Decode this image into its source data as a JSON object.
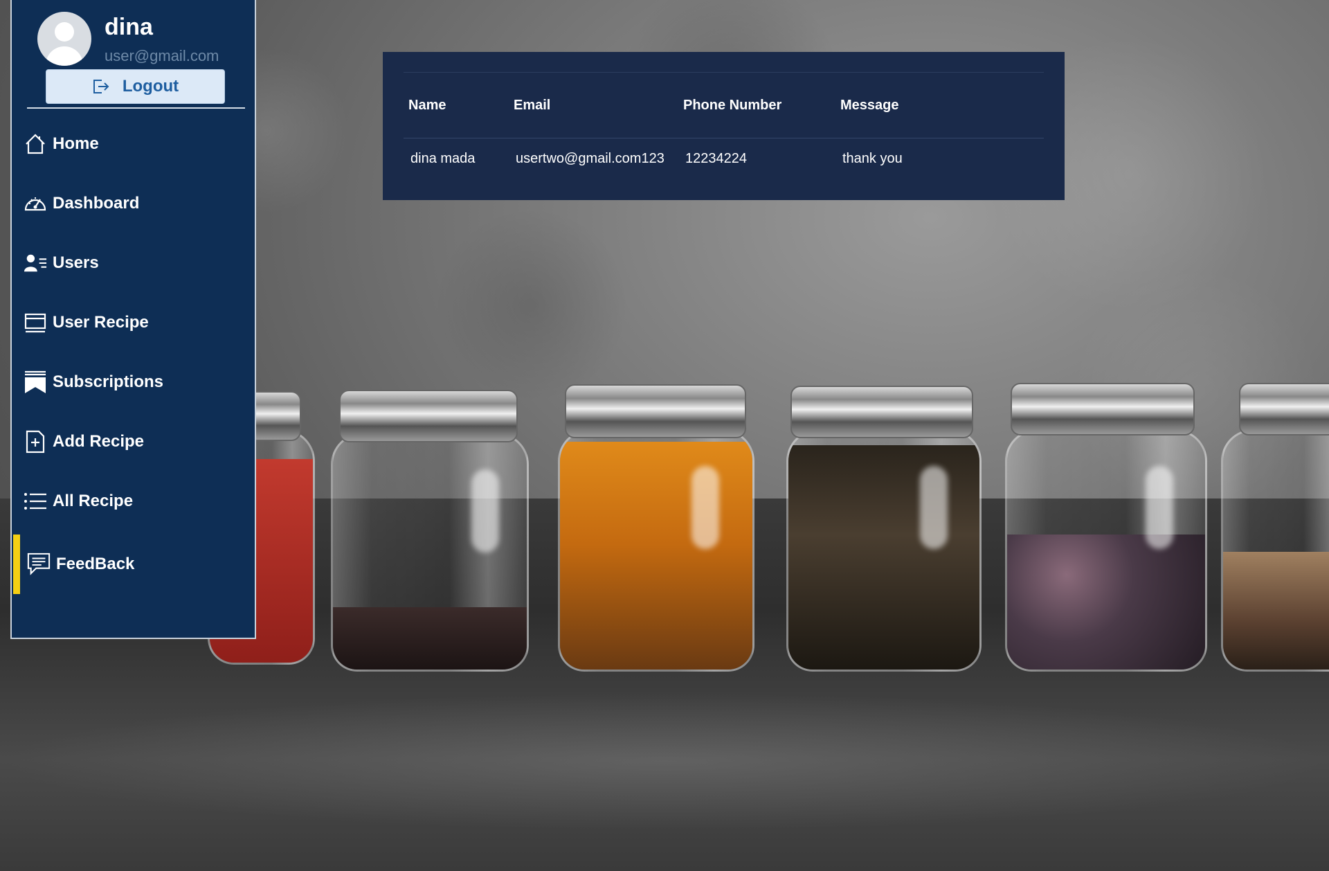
{
  "user": {
    "name": "dina",
    "email": "user@gmail.com",
    "logout_label": "Logout"
  },
  "sidebar": {
    "items": [
      {
        "label": "Home",
        "icon": "home-icon"
      },
      {
        "label": "Dashboard",
        "icon": "speedometer-icon"
      },
      {
        "label": "Users",
        "icon": "users-icon"
      },
      {
        "label": "User Recipe",
        "icon": "window-icon"
      },
      {
        "label": "Subscriptions",
        "icon": "bookmark-icon"
      },
      {
        "label": "Add Recipe",
        "icon": "file-plus-icon"
      },
      {
        "label": "All Recipe",
        "icon": "list-icon"
      },
      {
        "label": "FeedBack",
        "icon": "chat-icon",
        "active": true
      }
    ]
  },
  "feedback_table": {
    "headers": [
      "Name",
      "Email",
      "Phone Number",
      "Message"
    ],
    "rows": [
      [
        "dina mada",
        "usertwo@gmail.com123",
        "12234224",
        "thank you"
      ]
    ]
  },
  "colors": {
    "sidebar_bg": "#0e2e55",
    "card_bg": "#1a2a4a",
    "active_accent": "#f5cf13",
    "logout_bg": "#dce9f7",
    "logout_text": "#1e5ea0"
  }
}
